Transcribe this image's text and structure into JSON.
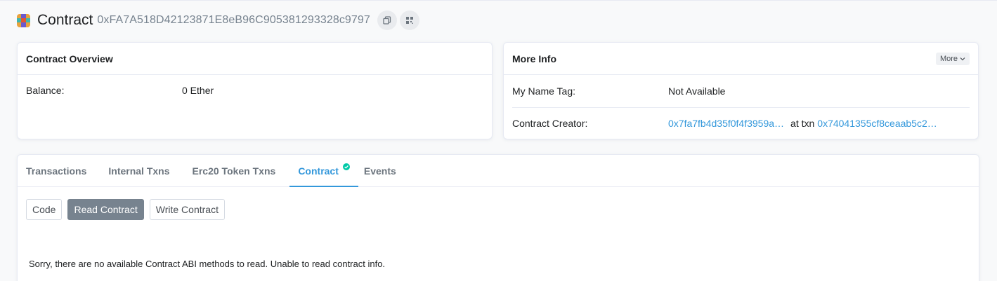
{
  "header": {
    "title": "Contract",
    "address": "0xFA7A518D42123871E8eB96C905381293328c9797",
    "avatar_colors": [
      "#e9a23b",
      "#6a5acd",
      "#e9a23b",
      "#3fb6b0",
      "#e4572e",
      "#3fb6b0",
      "#e9a23b",
      "#6a5acd",
      "#e9a23b"
    ]
  },
  "overview": {
    "title": "Contract Overview",
    "balance_label": "Balance:",
    "balance_value": "0 Ether"
  },
  "more_info": {
    "title": "More Info",
    "more_button": "More",
    "name_tag_label": "My Name Tag:",
    "name_tag_value": "Not Available",
    "creator_label": "Contract Creator:",
    "creator_address": "0x7fa7fb4d35f0f4f3959a…",
    "at_txn_label": "at txn",
    "creator_txn": "0x74041355cf8ceaab5c2…"
  },
  "tabs": [
    {
      "label": "Transactions"
    },
    {
      "label": "Internal Txns"
    },
    {
      "label": "Erc20 Token Txns"
    },
    {
      "label": "Contract"
    },
    {
      "label": "Events"
    }
  ],
  "sub_buttons": {
    "code": "Code",
    "read": "Read Contract",
    "write": "Write Contract"
  },
  "message": "Sorry, there are no available Contract ABI methods to read. Unable to read contract info.",
  "colors": {
    "accent": "#3498db",
    "verified": "#00c9a7",
    "active_button": "#77838f"
  }
}
